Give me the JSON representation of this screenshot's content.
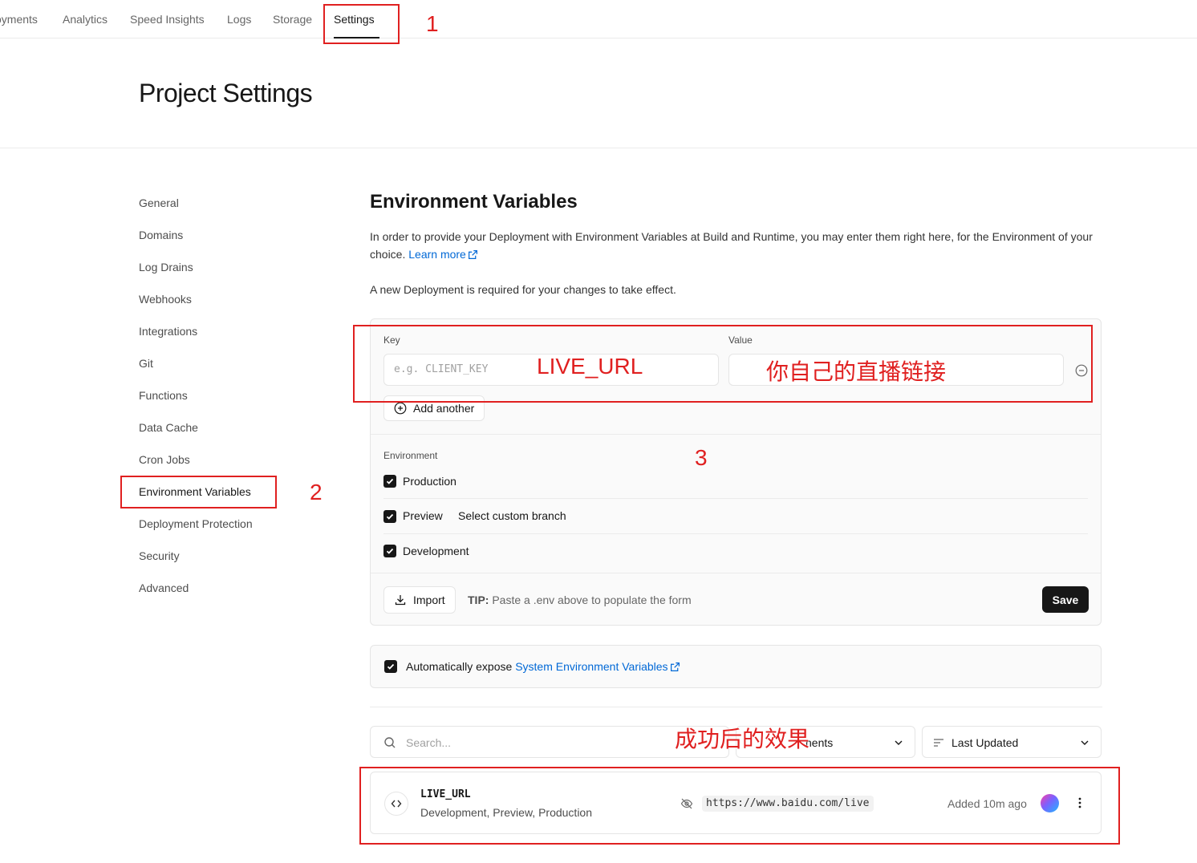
{
  "topnav": {
    "tabs": [
      "oyments",
      "Analytics",
      "Speed Insights",
      "Logs",
      "Storage",
      "Settings"
    ],
    "active": "Settings"
  },
  "page_title": "Project Settings",
  "sidebar": {
    "items": [
      "General",
      "Domains",
      "Log Drains",
      "Webhooks",
      "Integrations",
      "Git",
      "Functions",
      "Data Cache",
      "Cron Jobs",
      "Environment Variables",
      "Deployment Protection",
      "Security",
      "Advanced"
    ],
    "active": "Environment Variables"
  },
  "env": {
    "title": "Environment Variables",
    "description": "In order to provide your Deployment with Environment Variables at Build and Runtime, you may enter them right here, for the Environment of your choice.",
    "learn_more": "Learn more",
    "note": "A new Deployment is required for your changes to take effect.",
    "key_label": "Key",
    "key_placeholder": "e.g. CLIENT_KEY",
    "value_label": "Value",
    "add_another": "Add another",
    "environment_label": "Environment",
    "environments": [
      {
        "label": "Production",
        "checked": true
      },
      {
        "label": "Preview",
        "checked": true
      },
      {
        "label": "Development",
        "checked": true
      }
    ],
    "select_branch": "Select custom branch",
    "import_label": "Import",
    "tip_bold": "TIP:",
    "tip_text": "Paste a .env above to populate the form",
    "save_label": "Save"
  },
  "expose": {
    "text": "Automatically expose",
    "link": "System Environment Variables",
    "checked": true
  },
  "filters": {
    "search_placeholder": "Search...",
    "env_filter": "nents",
    "sort": "Last Updated"
  },
  "variable_row": {
    "name": "LIVE_URL",
    "environments": "Development, Preview, Production",
    "value": "https://www.baidu.com/live",
    "added": "Added 10m ago"
  },
  "annotations": {
    "num1": "1",
    "num2": "2",
    "num3": "3",
    "key_text": "LIVE_URL",
    "value_text": "你自己的直播链接",
    "result_text": "成功后的效果"
  },
  "colors": {
    "annotation": "#e02020",
    "link": "#0068d6",
    "primary": "#171717"
  }
}
